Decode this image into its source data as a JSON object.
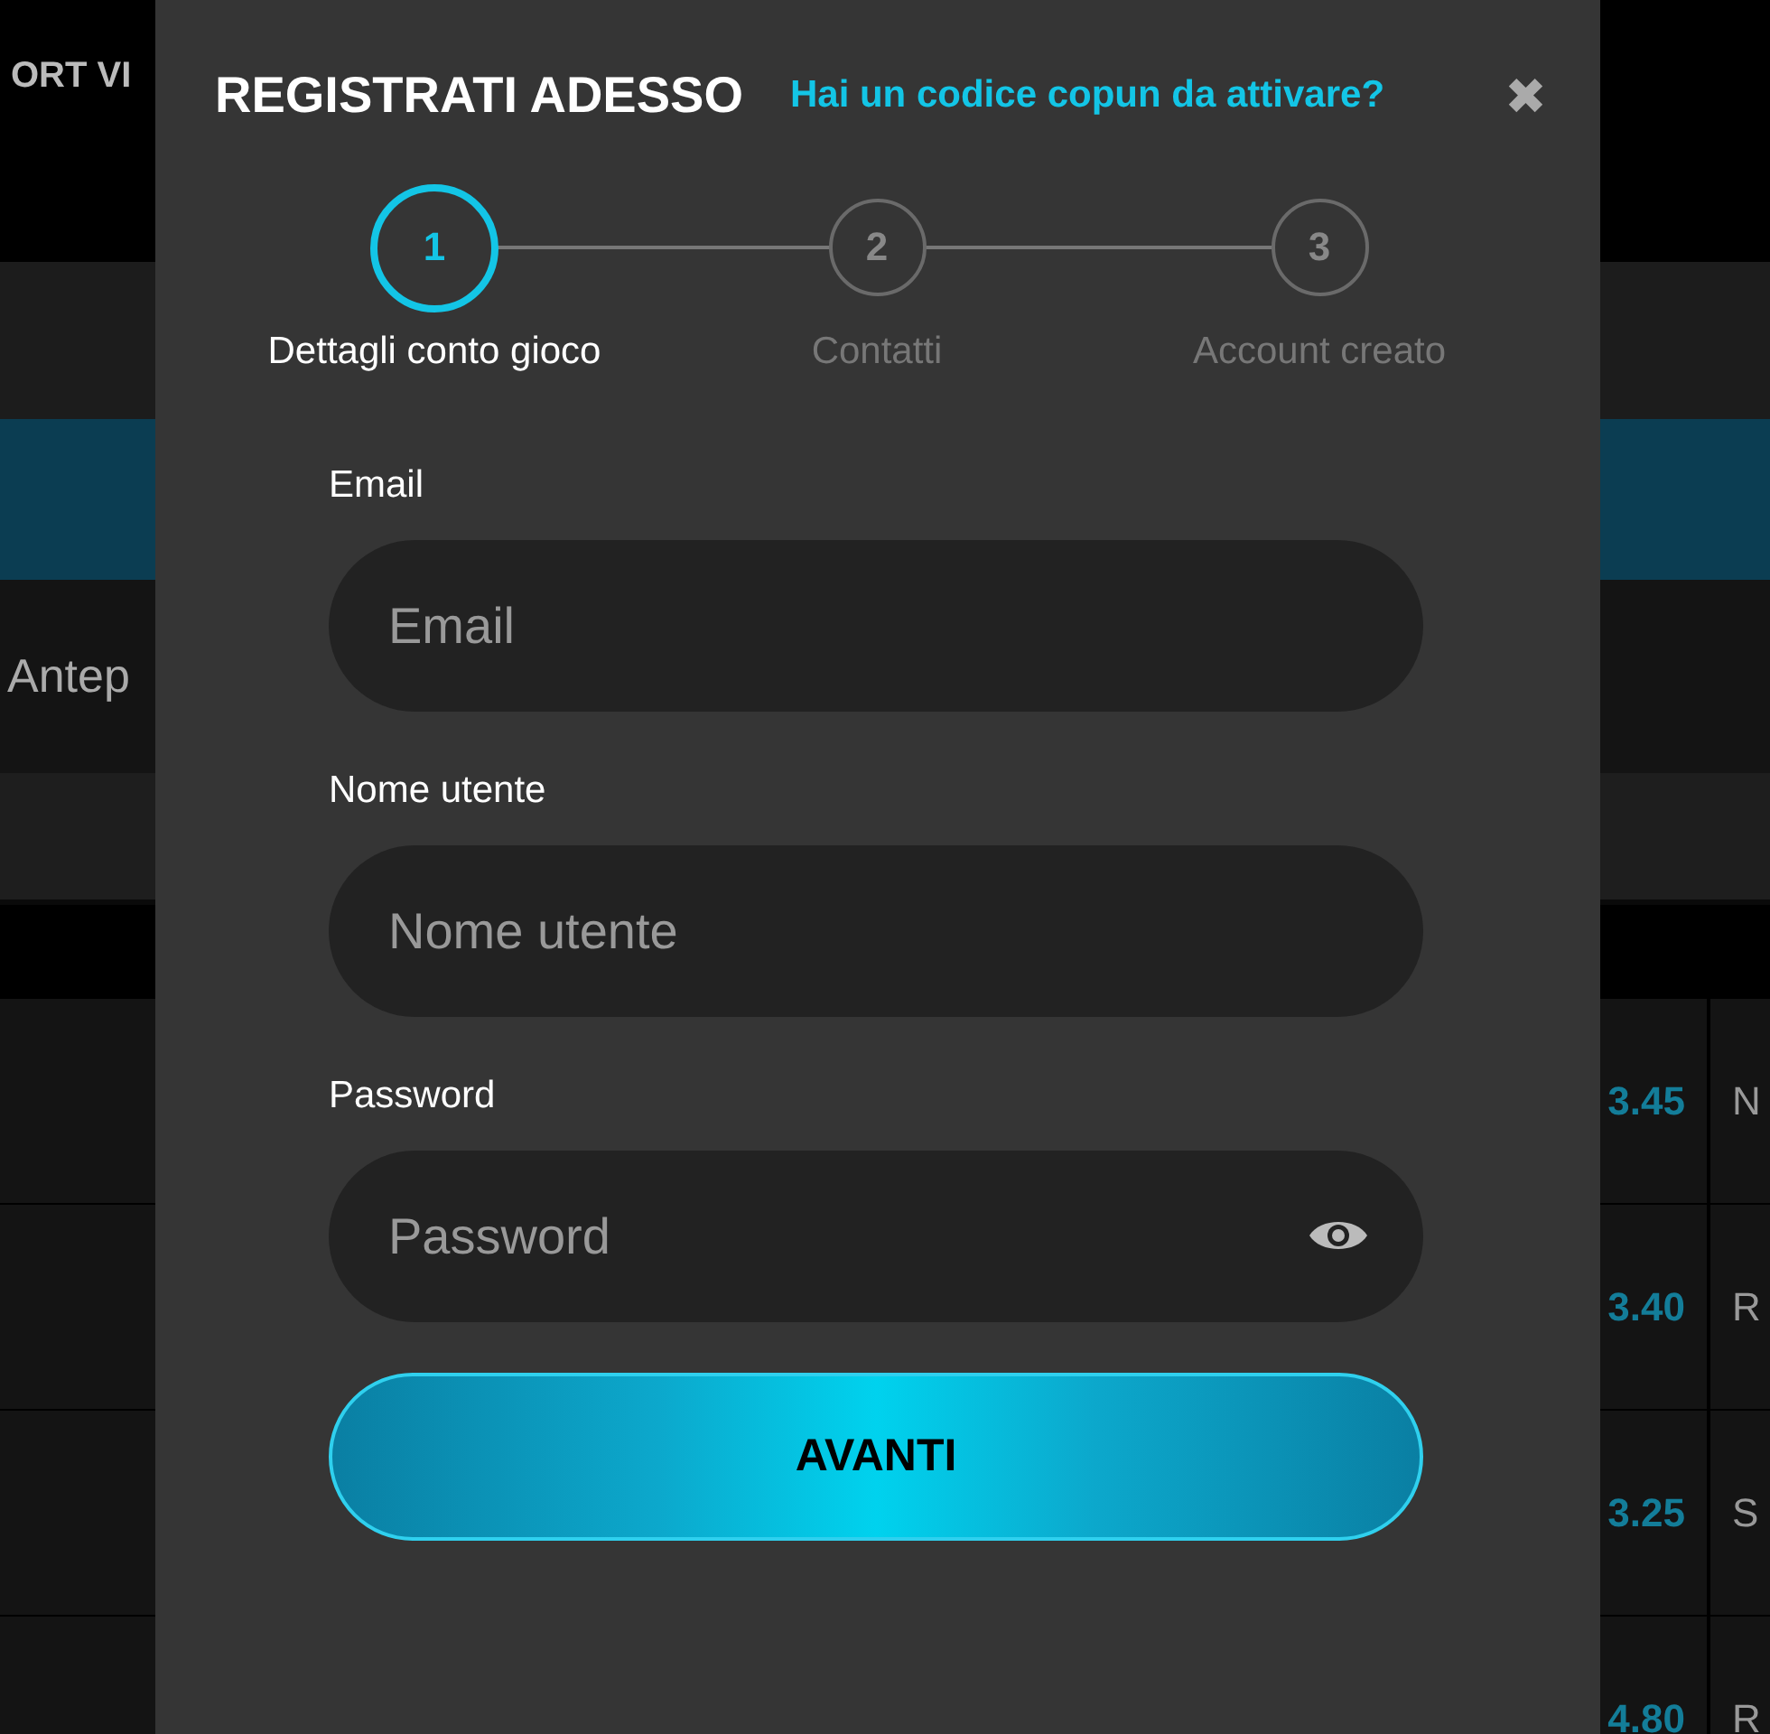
{
  "background": {
    "top_label": "ORT VI",
    "section_label": "Antep",
    "rows": [
      {
        "odds": "3.45",
        "name": "N"
      },
      {
        "odds": "3.40",
        "name": "R"
      },
      {
        "odds": "3.25",
        "name": "S"
      },
      {
        "odds": "4.80",
        "name": "R"
      }
    ]
  },
  "dialog": {
    "title": "REGISTRATI ADESSO",
    "coupon_link": "Hai un codice copun da attivare?",
    "close": "✖",
    "steps": [
      {
        "number": "1",
        "label": "Dettagli conto gioco",
        "selected": true
      },
      {
        "number": "2",
        "label": "Contatti",
        "selected": false
      },
      {
        "number": "3",
        "label": "Account creato",
        "selected": false
      }
    ],
    "fields": [
      {
        "label": "Email",
        "placeholder": "Email",
        "kind": "text"
      },
      {
        "label": "Nome utente",
        "placeholder": "Nome utente",
        "kind": "text"
      },
      {
        "label": "Password",
        "placeholder": "Password",
        "kind": "password"
      }
    ],
    "submit": "AVANTI"
  }
}
